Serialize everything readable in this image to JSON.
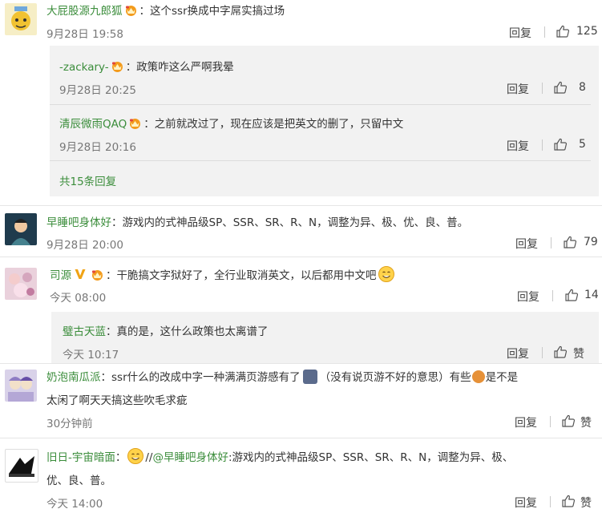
{
  "comments": [
    {
      "name": "大屁股源九郎狐",
      "text": "：这个ssr换成中字屌实搞过场",
      "time": "9月28日 19:58",
      "reply_label": "回复",
      "likes": "125",
      "replies": [
        {
          "name": "-zackary-",
          "text": "：政策咋这么严啊我晕",
          "time": "9月28日 20:25",
          "reply_label": "回复",
          "likes": "8"
        },
        {
          "name": "清辰微雨QAQ",
          "text": "：之前就改过了，现在应该是把英文的删了，只留中文",
          "time": "9月28日 20:16",
          "reply_label": "回复",
          "likes": "5"
        }
      ],
      "total_replies": "共15条回复"
    },
    {
      "name": "早睡吧身体好",
      "text": "：游戏内的式神品级SP、SSR、SR、R、N，调整为异、极、优、良、普。",
      "time": "9月28日 20:00",
      "reply_label": "回复",
      "likes": "79"
    },
    {
      "name": "司源",
      "text": "：干脆搞文字狱好了，全行业取消英文，以后都用中文吧",
      "time": "今天 08:00",
      "reply_label": "回复",
      "likes": "14",
      "replies": [
        {
          "name": "璧古天蓝",
          "text": "：真的是，这什么政策也太离谱了",
          "time": "今天 10:17",
          "reply_label": "回复",
          "likes": "赞"
        }
      ]
    },
    {
      "name": "奶泡南瓜派",
      "text_line1a": "：ssr什么的改成中字一种满满页游感有了",
      "text_line1b": "（没有说页游不好的意思）有些",
      "text_line1c": "是不是",
      "text_line2": "太闲了啊天天搞这些吹毛求疵",
      "time": "30分钟前",
      "reply_label": "回复",
      "likes": "赞"
    },
    {
      "name": "旧日-宇宙暗面",
      "text_sep": "：",
      "text_mid": "//",
      "mention": "@早睡吧身体好",
      "text_line1": ":游戏内的式神品级SP、SSR、SR、R、N，调整为异、极、",
      "text_line2": "优、良、普。",
      "time": "今天 14:00",
      "reply_label": "回复",
      "likes": "赞"
    }
  ],
  "colors": {
    "name": "#3b8d3b",
    "subbox": "#f2f2f2",
    "meta": "#777777"
  }
}
